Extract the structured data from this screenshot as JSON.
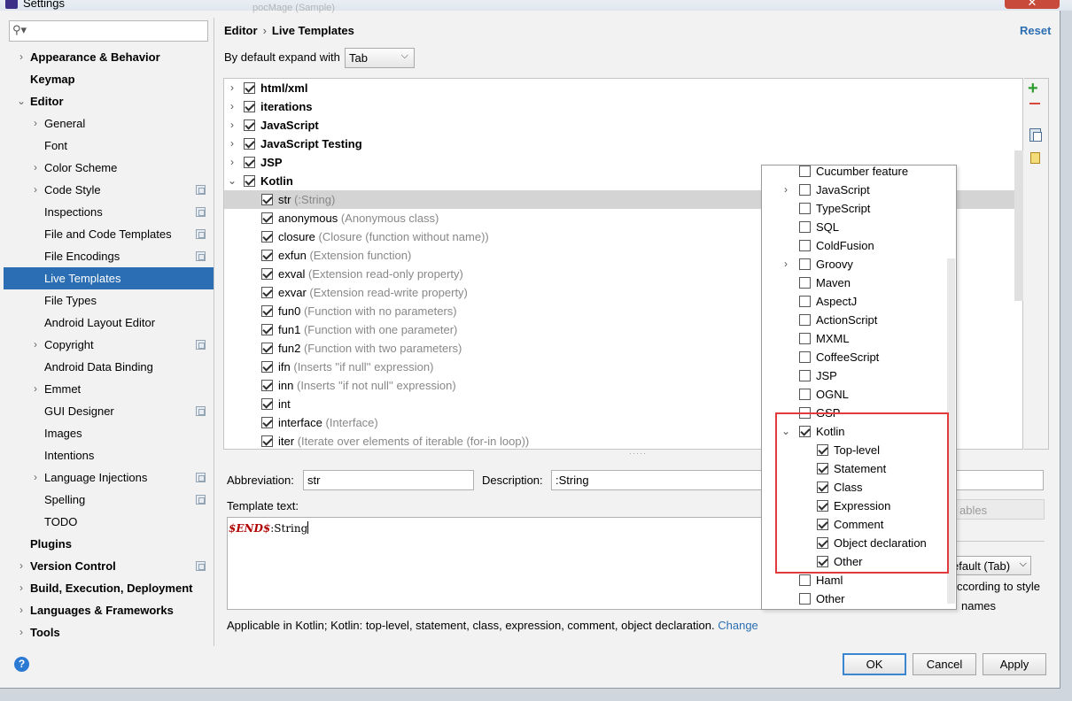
{
  "window": {
    "title": "Settings",
    "faded_title": "pocMage (Sample)",
    "close_label": "✕"
  },
  "search": {
    "icon": "search-icon",
    "placeholder": ""
  },
  "nav": [
    {
      "label": "Appearance & Behavior",
      "bold": true,
      "arrow": "›",
      "indent": 0,
      "flag": false,
      "selected": false
    },
    {
      "label": "Keymap",
      "bold": true,
      "arrow": "",
      "indent": 0,
      "flag": false,
      "selected": false
    },
    {
      "label": "Editor",
      "bold": true,
      "arrow": "⌄",
      "indent": 0,
      "flag": false,
      "selected": false
    },
    {
      "label": "General",
      "bold": false,
      "arrow": "›",
      "indent": 1,
      "flag": false,
      "selected": false
    },
    {
      "label": "Font",
      "bold": false,
      "arrow": "",
      "indent": 1,
      "flag": false,
      "selected": false
    },
    {
      "label": "Color Scheme",
      "bold": false,
      "arrow": "›",
      "indent": 1,
      "flag": false,
      "selected": false
    },
    {
      "label": "Code Style",
      "bold": false,
      "arrow": "›",
      "indent": 1,
      "flag": true,
      "selected": false
    },
    {
      "label": "Inspections",
      "bold": false,
      "arrow": "",
      "indent": 1,
      "flag": true,
      "selected": false
    },
    {
      "label": "File and Code Templates",
      "bold": false,
      "arrow": "",
      "indent": 1,
      "flag": true,
      "selected": false
    },
    {
      "label": "File Encodings",
      "bold": false,
      "arrow": "",
      "indent": 1,
      "flag": true,
      "selected": false
    },
    {
      "label": "Live Templates",
      "bold": false,
      "arrow": "",
      "indent": 1,
      "flag": false,
      "selected": true
    },
    {
      "label": "File Types",
      "bold": false,
      "arrow": "",
      "indent": 1,
      "flag": false,
      "selected": false
    },
    {
      "label": "Android Layout Editor",
      "bold": false,
      "arrow": "",
      "indent": 1,
      "flag": false,
      "selected": false
    },
    {
      "label": "Copyright",
      "bold": false,
      "arrow": "›",
      "indent": 1,
      "flag": true,
      "selected": false
    },
    {
      "label": "Android Data Binding",
      "bold": false,
      "arrow": "",
      "indent": 1,
      "flag": false,
      "selected": false
    },
    {
      "label": "Emmet",
      "bold": false,
      "arrow": "›",
      "indent": 1,
      "flag": false,
      "selected": false
    },
    {
      "label": "GUI Designer",
      "bold": false,
      "arrow": "",
      "indent": 1,
      "flag": true,
      "selected": false
    },
    {
      "label": "Images",
      "bold": false,
      "arrow": "",
      "indent": 1,
      "flag": false,
      "selected": false
    },
    {
      "label": "Intentions",
      "bold": false,
      "arrow": "",
      "indent": 1,
      "flag": false,
      "selected": false
    },
    {
      "label": "Language Injections",
      "bold": false,
      "arrow": "›",
      "indent": 1,
      "flag": true,
      "selected": false
    },
    {
      "label": "Spelling",
      "bold": false,
      "arrow": "",
      "indent": 1,
      "flag": true,
      "selected": false
    },
    {
      "label": "TODO",
      "bold": false,
      "arrow": "",
      "indent": 1,
      "flag": false,
      "selected": false
    },
    {
      "label": "Plugins",
      "bold": true,
      "arrow": "",
      "indent": 0,
      "flag": false,
      "selected": false
    },
    {
      "label": "Version Control",
      "bold": true,
      "arrow": "›",
      "indent": 0,
      "flag": true,
      "selected": false
    },
    {
      "label": "Build, Execution, Deployment",
      "bold": true,
      "arrow": "›",
      "indent": 0,
      "flag": false,
      "selected": false
    },
    {
      "label": "Languages & Frameworks",
      "bold": true,
      "arrow": "›",
      "indent": 0,
      "flag": false,
      "selected": false
    },
    {
      "label": "Tools",
      "bold": true,
      "arrow": "›",
      "indent": 0,
      "flag": false,
      "selected": false
    }
  ],
  "header": {
    "crumb_parent": "Editor",
    "crumb_sep": "›",
    "crumb_current": "Live Templates",
    "reset_label": "Reset"
  },
  "expand": {
    "label": "By default expand with",
    "value": "Tab",
    "dropdown_icon": "⌵"
  },
  "templates": [
    {
      "arrow": "›",
      "checked": true,
      "name": "html/xml",
      "desc": "",
      "group": true,
      "selected": false
    },
    {
      "arrow": "›",
      "checked": true,
      "name": "iterations",
      "desc": "",
      "group": true,
      "selected": false
    },
    {
      "arrow": "›",
      "checked": true,
      "name": "JavaScript",
      "desc": "",
      "group": true,
      "selected": false
    },
    {
      "arrow": "›",
      "checked": true,
      "name": "JavaScript Testing",
      "desc": "",
      "group": true,
      "selected": false
    },
    {
      "arrow": "›",
      "checked": true,
      "name": "JSP",
      "desc": "",
      "group": true,
      "selected": false
    },
    {
      "arrow": "⌄",
      "checked": true,
      "name": "Kotlin",
      "desc": "",
      "group": true,
      "selected": false
    },
    {
      "arrow": "",
      "checked": true,
      "name": "str",
      "desc": "(:String)",
      "group": false,
      "selected": true
    },
    {
      "arrow": "",
      "checked": true,
      "name": "anonymous",
      "desc": "(Anonymous class)",
      "group": false,
      "selected": false
    },
    {
      "arrow": "",
      "checked": true,
      "name": "closure",
      "desc": "(Closure (function without name))",
      "group": false,
      "selected": false
    },
    {
      "arrow": "",
      "checked": true,
      "name": "exfun",
      "desc": "(Extension function)",
      "group": false,
      "selected": false
    },
    {
      "arrow": "",
      "checked": true,
      "name": "exval",
      "desc": "(Extension read-only property)",
      "group": false,
      "selected": false
    },
    {
      "arrow": "",
      "checked": true,
      "name": "exvar",
      "desc": "(Extension read-write property)",
      "group": false,
      "selected": false
    },
    {
      "arrow": "",
      "checked": true,
      "name": "fun0",
      "desc": "(Function with no parameters)",
      "group": false,
      "selected": false
    },
    {
      "arrow": "",
      "checked": true,
      "name": "fun1",
      "desc": "(Function with one parameter)",
      "group": false,
      "selected": false
    },
    {
      "arrow": "",
      "checked": true,
      "name": "fun2",
      "desc": "(Function with two parameters)",
      "group": false,
      "selected": false
    },
    {
      "arrow": "",
      "checked": true,
      "name": "ifn",
      "desc": "(Inserts ''if null'' expression)",
      "group": false,
      "selected": false
    },
    {
      "arrow": "",
      "checked": true,
      "name": "inn",
      "desc": "(Inserts ''if not null'' expression)",
      "group": false,
      "selected": false
    },
    {
      "arrow": "",
      "checked": true,
      "name": "int",
      "desc": "",
      "group": false,
      "selected": false
    },
    {
      "arrow": "",
      "checked": true,
      "name": "interface",
      "desc": "(Interface)",
      "group": false,
      "selected": false
    },
    {
      "arrow": "",
      "checked": true,
      "name": "iter",
      "desc": "(Iterate over elements of iterable (for-in loop))",
      "group": false,
      "selected": false
    }
  ],
  "toolbar": {
    "add_icon": "+",
    "remove_icon": "minus-icon",
    "copy_icon": "copy-icon",
    "note_icon": "note-icon"
  },
  "editor": {
    "abbreviation_label": "Abbreviation:",
    "abbreviation_value": "str",
    "description_label": "Description:",
    "description_value": ":String",
    "template_label": "Template text:",
    "template_var": "$END$",
    "template_rest": ":String",
    "vars_button": "ables",
    "expand2_value": "efault (Tab)",
    "opt1": "ccording to style",
    "opt2": "names",
    "applicable_text": "Applicable in Kotlin; Kotlin: top-level, statement, class, expression, comment, object declaration.",
    "change_link": "Change"
  },
  "context_popup": [
    {
      "arrow": "",
      "checked": false,
      "label": "Cucumber feature",
      "indent": 0
    },
    {
      "arrow": "›",
      "checked": false,
      "label": "JavaScript",
      "indent": 0
    },
    {
      "arrow": "",
      "checked": false,
      "label": "TypeScript",
      "indent": 0
    },
    {
      "arrow": "",
      "checked": false,
      "label": "SQL",
      "indent": 0
    },
    {
      "arrow": "",
      "checked": false,
      "label": "ColdFusion",
      "indent": 0
    },
    {
      "arrow": "›",
      "checked": false,
      "label": "Groovy",
      "indent": 0
    },
    {
      "arrow": "",
      "checked": false,
      "label": "Maven",
      "indent": 0
    },
    {
      "arrow": "",
      "checked": false,
      "label": "AspectJ",
      "indent": 0
    },
    {
      "arrow": "",
      "checked": false,
      "label": "ActionScript",
      "indent": 0
    },
    {
      "arrow": "",
      "checked": false,
      "label": "MXML",
      "indent": 0
    },
    {
      "arrow": "",
      "checked": false,
      "label": "CoffeeScript",
      "indent": 0
    },
    {
      "arrow": "",
      "checked": false,
      "label": "JSP",
      "indent": 0
    },
    {
      "arrow": "",
      "checked": false,
      "label": "OGNL",
      "indent": 0
    },
    {
      "arrow": "",
      "checked": false,
      "label": "GSP",
      "indent": 0
    },
    {
      "arrow": "⌄",
      "checked": true,
      "label": "Kotlin",
      "indent": 0
    },
    {
      "arrow": "",
      "checked": true,
      "label": "Top-level",
      "indent": 1
    },
    {
      "arrow": "",
      "checked": true,
      "label": "Statement",
      "indent": 1
    },
    {
      "arrow": "",
      "checked": true,
      "label": "Class",
      "indent": 1
    },
    {
      "arrow": "",
      "checked": true,
      "label": "Expression",
      "indent": 1
    },
    {
      "arrow": "",
      "checked": true,
      "label": "Comment",
      "indent": 1
    },
    {
      "arrow": "",
      "checked": true,
      "label": "Object declaration",
      "indent": 1
    },
    {
      "arrow": "",
      "checked": true,
      "label": "Other",
      "indent": 1
    },
    {
      "arrow": "",
      "checked": false,
      "label": "Haml",
      "indent": 0
    },
    {
      "arrow": "",
      "checked": false,
      "label": "Other",
      "indent": 0
    }
  ],
  "buttons": {
    "help": "?",
    "ok": "OK",
    "cancel": "Cancel",
    "apply": "Apply"
  },
  "colors": {
    "selection": "#2b6eb3",
    "highlight_box": "#e23b3b",
    "link": "#2b6eb3"
  }
}
